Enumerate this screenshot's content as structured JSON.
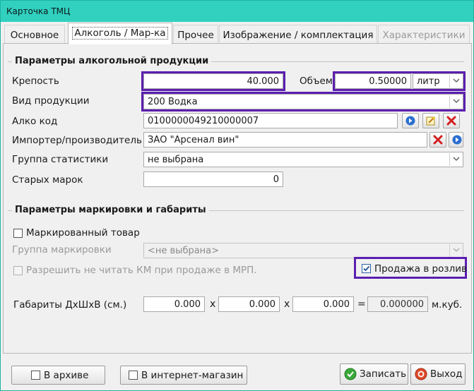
{
  "window": {
    "title": "Карточка ТМЦ"
  },
  "tabs": [
    {
      "label": "Основное"
    },
    {
      "label": "Алкоголь / Мар-ка"
    },
    {
      "label": "Прочее"
    },
    {
      "label": "Изображение / комплектация"
    },
    {
      "label": "Характеристики"
    }
  ],
  "alcohol": {
    "section_title": "Параметры алкогольной продукции",
    "strength_label": "Крепость",
    "strength_value": "40.000",
    "volume_label": "Объем",
    "volume_value": "0.50000",
    "volume_unit": "литр",
    "product_type_label": "Вид продукции",
    "product_type_value": "200 Водка",
    "alco_code_label": "Алко код",
    "alco_code_value": "0100000049210000007",
    "importer_label": "Импортер/производитель",
    "importer_value": "ЗАО \"Арсенал вин\"",
    "stat_group_label": "Группа статистики",
    "stat_group_value": "не выбрана",
    "old_marks_label": "Старых марок",
    "old_marks_value": "0"
  },
  "marking": {
    "section_title": "Параметры маркировки и габариты",
    "marked_label": "Маркированный товар",
    "marked_checked": false,
    "group_label": "Группа маркировки",
    "group_value": "<не выбрана>",
    "allow_label": "Разрешить не читать КМ при продаже в МРП.",
    "draft_label": "Продажа в розлив",
    "draft_checked": true,
    "dims_label": "Габариты ДхШхВ (см.)",
    "dim_length": "0.000",
    "dim_width": "0.000",
    "dim_height": "0.000",
    "times_sign": "x",
    "equals_sign": "=",
    "volume_result": "0.000000",
    "volume_unit": "м.куб."
  },
  "footer": {
    "archive_label": "В архиве",
    "shop_label": "В интернет-магазин",
    "save_label": "Записать",
    "exit_label": "Выход"
  },
  "colors": {
    "highlight": "#5b1fb0",
    "titlebar": "#31d0bf",
    "arrow_blue": "#2a6fd0",
    "delete_red": "#d42020"
  }
}
